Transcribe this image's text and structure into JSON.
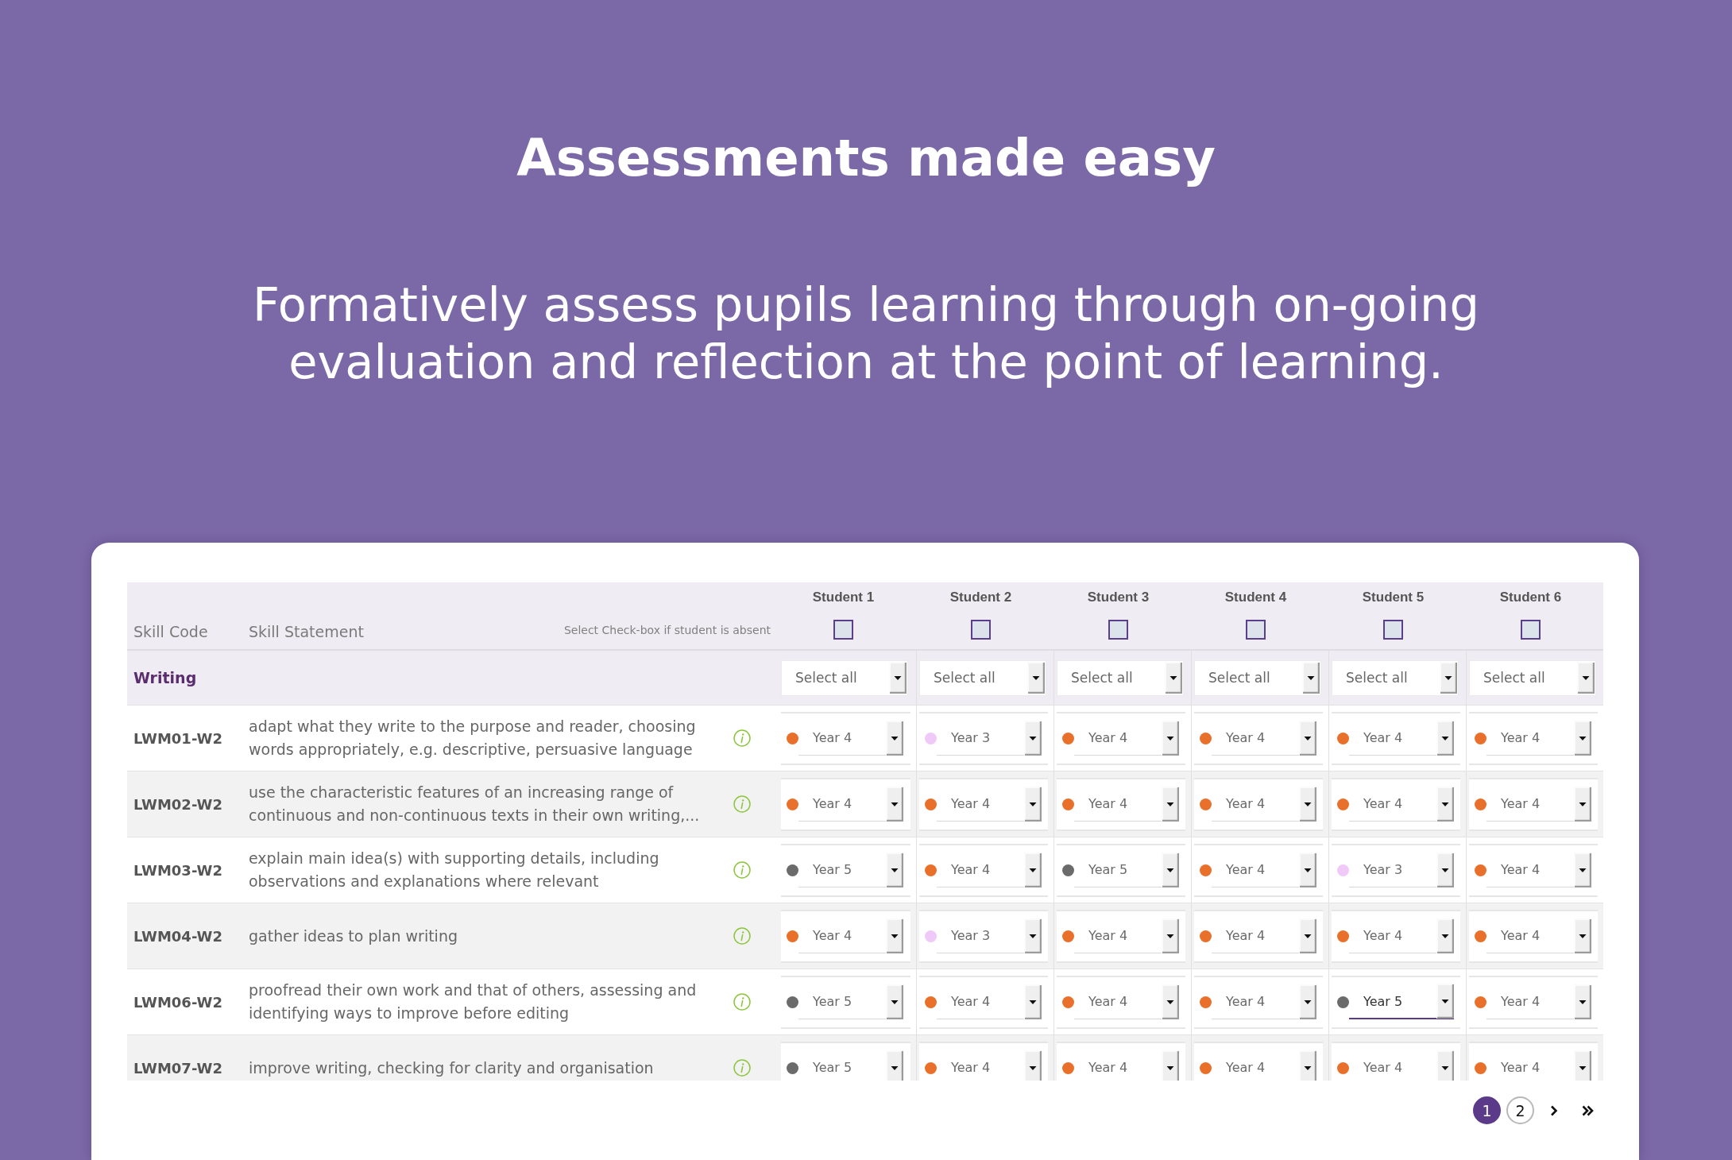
{
  "hero": {
    "title": "Assessments made easy",
    "subtitle": "Formatively assess pupils learning through on-going evaluation and reflection at the point of learning."
  },
  "table": {
    "columns": {
      "skill_code": "Skill Code",
      "skill_statement": "Skill Statement",
      "absent_hint": "Select Check-box if student is absent"
    },
    "students": [
      {
        "name": "Student 1",
        "checked": false
      },
      {
        "name": "Student 2",
        "checked": false
      },
      {
        "name": "Student 3",
        "checked": false
      },
      {
        "name": "Student 4",
        "checked": false
      },
      {
        "name": "Student 5",
        "checked": false
      },
      {
        "name": "Student 6",
        "checked": false
      }
    ],
    "group": {
      "label": "Writing",
      "select_all": [
        "Select all",
        "Select all",
        "Select all",
        "Select all",
        "Select all",
        "Select all"
      ]
    },
    "rows": [
      {
        "code": "LWM01-W2",
        "statement": "adapt what they write to the purpose and reader, choosing words appropriately, e.g. descriptive, persuasive language",
        "grades": [
          {
            "label": "Year 4",
            "color": "#e8702a",
            "focused": false
          },
          {
            "label": "Year 3",
            "color": "#efc9f7",
            "focused": false
          },
          {
            "label": "Year 4",
            "color": "#e8702a",
            "focused": false
          },
          {
            "label": "Year 4",
            "color": "#e8702a",
            "focused": false
          },
          {
            "label": "Year 4",
            "color": "#e8702a",
            "focused": false
          },
          {
            "label": "Year 4",
            "color": "#e8702a",
            "focused": false
          }
        ]
      },
      {
        "code": "LWM02-W2",
        "statement": "use the characteristic features of an increasing range of continuous and non-continuous texts in their own writing,...",
        "grades": [
          {
            "label": "Year 4",
            "color": "#e8702a",
            "focused": false
          },
          {
            "label": "Year 4",
            "color": "#e8702a",
            "focused": false
          },
          {
            "label": "Year 4",
            "color": "#e8702a",
            "focused": false
          },
          {
            "label": "Year 4",
            "color": "#e8702a",
            "focused": false
          },
          {
            "label": "Year 4",
            "color": "#e8702a",
            "focused": false
          },
          {
            "label": "Year 4",
            "color": "#e8702a",
            "focused": false
          }
        ]
      },
      {
        "code": "LWM03-W2",
        "statement": "explain main idea(s) with supporting details, including observations and explanations where relevant",
        "grades": [
          {
            "label": "Year 5",
            "color": "#6b6b6b",
            "focused": false
          },
          {
            "label": "Year 4",
            "color": "#e8702a",
            "focused": false
          },
          {
            "label": "Year 5",
            "color": "#6b6b6b",
            "focused": false
          },
          {
            "label": "Year 4",
            "color": "#e8702a",
            "focused": false
          },
          {
            "label": "Year 3",
            "color": "#efc9f7",
            "focused": false
          },
          {
            "label": "Year 4",
            "color": "#e8702a",
            "focused": false
          }
        ]
      },
      {
        "code": "LWM04-W2",
        "statement": "gather ideas to plan writing",
        "grades": [
          {
            "label": "Year 4",
            "color": "#e8702a",
            "focused": false
          },
          {
            "label": "Year 3",
            "color": "#efc9f7",
            "focused": false
          },
          {
            "label": "Year 4",
            "color": "#e8702a",
            "focused": false
          },
          {
            "label": "Year 4",
            "color": "#e8702a",
            "focused": false
          },
          {
            "label": "Year 4",
            "color": "#e8702a",
            "focused": false
          },
          {
            "label": "Year 4",
            "color": "#e8702a",
            "focused": false
          }
        ]
      },
      {
        "code": "LWM06-W2",
        "statement": "proofread their own work and that of others, assessing and identifying ways to improve before editing",
        "grades": [
          {
            "label": "Year 5",
            "color": "#6b6b6b",
            "focused": false
          },
          {
            "label": "Year 4",
            "color": "#e8702a",
            "focused": false
          },
          {
            "label": "Year 4",
            "color": "#e8702a",
            "focused": false
          },
          {
            "label": "Year 4",
            "color": "#e8702a",
            "focused": false
          },
          {
            "label": "Year 5",
            "color": "#6b6b6b",
            "focused": true
          },
          {
            "label": "Year 4",
            "color": "#e8702a",
            "focused": false
          }
        ]
      },
      {
        "code": "LWM07-W2",
        "statement": "improve writing, checking for clarity and organisation",
        "grades": [
          {
            "label": "Year 5",
            "color": "#6b6b6b",
            "focused": false
          },
          {
            "label": "Year 4",
            "color": "#e8702a",
            "focused": false
          },
          {
            "label": "Year 4",
            "color": "#e8702a",
            "focused": false
          },
          {
            "label": "Year 4",
            "color": "#e8702a",
            "focused": false
          },
          {
            "label": "Year 4",
            "color": "#e8702a",
            "focused": false
          },
          {
            "label": "Year 4",
            "color": "#e8702a",
            "focused": false
          }
        ]
      }
    ]
  },
  "pagination": {
    "pages": [
      {
        "label": "1",
        "selected": true
      },
      {
        "label": "2",
        "selected": false
      }
    ]
  }
}
